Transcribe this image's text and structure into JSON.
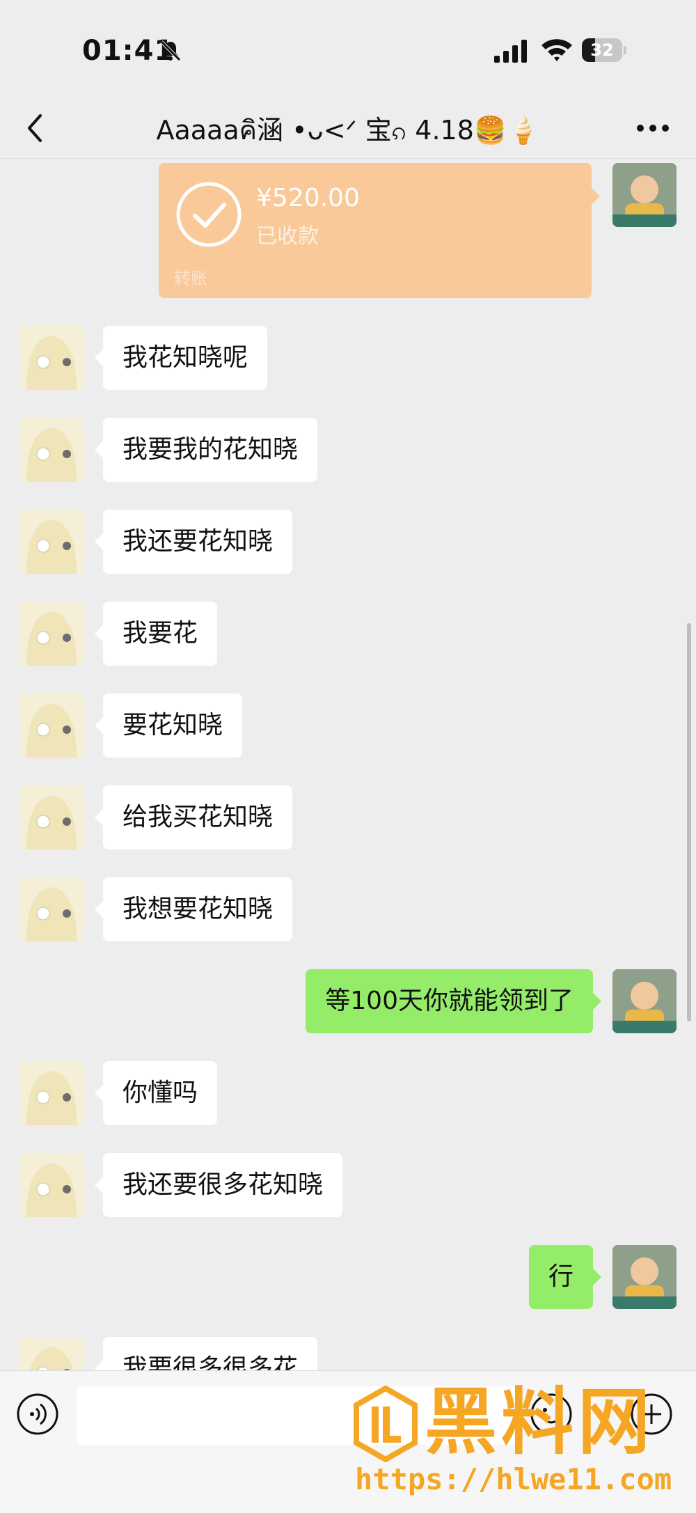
{
  "status_bar": {
    "time": "01:41",
    "battery": "32",
    "battery_level": 0.32,
    "icons": [
      "bell-off-icon",
      "signal-icon",
      "wifi-icon",
      "battery-icon"
    ]
  },
  "nav": {
    "title": "Aaaaaคิ涵 •ᴗ<ᐟ 宝ၵ 4.18🍔🍦",
    "icons": [
      "back-arrow-icon",
      "more-icon"
    ]
  },
  "transfer": {
    "amount": "¥520.00",
    "status": "已收款",
    "label": "转账",
    "color": "#f9c99a"
  },
  "messages": [
    {
      "side": "left",
      "text": "我花知晓呢"
    },
    {
      "side": "left",
      "text": "我要我的花知晓"
    },
    {
      "side": "left",
      "text": "我还要花知晓"
    },
    {
      "side": "left",
      "text": "我要花"
    },
    {
      "side": "left",
      "text": "要花知晓"
    },
    {
      "side": "left",
      "text": "给我买花知晓"
    },
    {
      "side": "left",
      "text": "我想要花知晓"
    },
    {
      "side": "right",
      "text": "等100天你就能领到了"
    },
    {
      "side": "left",
      "text": "你懂吗"
    },
    {
      "side": "left",
      "text": "我还要很多花知晓"
    },
    {
      "side": "right",
      "text": "行"
    },
    {
      "side": "left",
      "text": "我要很多很多花"
    }
  ],
  "colors": {
    "background": "#ededed",
    "bubble_self": "#95ec69",
    "bubble_other": "#ffffff",
    "watermark": "#f5a623"
  },
  "input": {
    "value": "",
    "icons": [
      "voice-icon",
      "emoji-icon",
      "plus-icon"
    ]
  },
  "watermark": {
    "name": "黑料网",
    "url": "https://hlwe11.com"
  }
}
